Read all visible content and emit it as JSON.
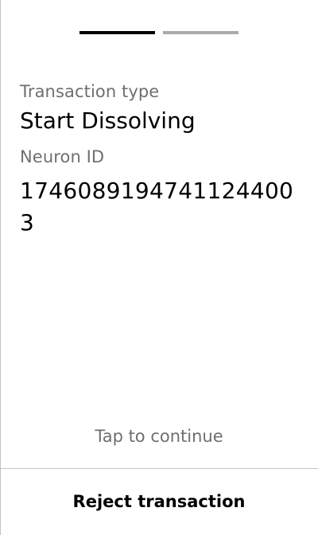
{
  "colors": {
    "progress_active": "#000000",
    "progress_inactive": "#aaaaaa",
    "label_text": "#6f6f6f",
    "value_text": "#000000",
    "divider": "#c4c4c4",
    "background": "#ffffff"
  },
  "progress": {
    "total_steps": 2,
    "current_step": 1
  },
  "transaction": {
    "type_label": "Transaction type",
    "type_value": "Start Dissolving",
    "neuron_label": "Neuron ID",
    "neuron_value": "17460891947411244003"
  },
  "footer": {
    "tap_to_continue": "Tap to continue",
    "reject_label": "Reject transaction"
  }
}
